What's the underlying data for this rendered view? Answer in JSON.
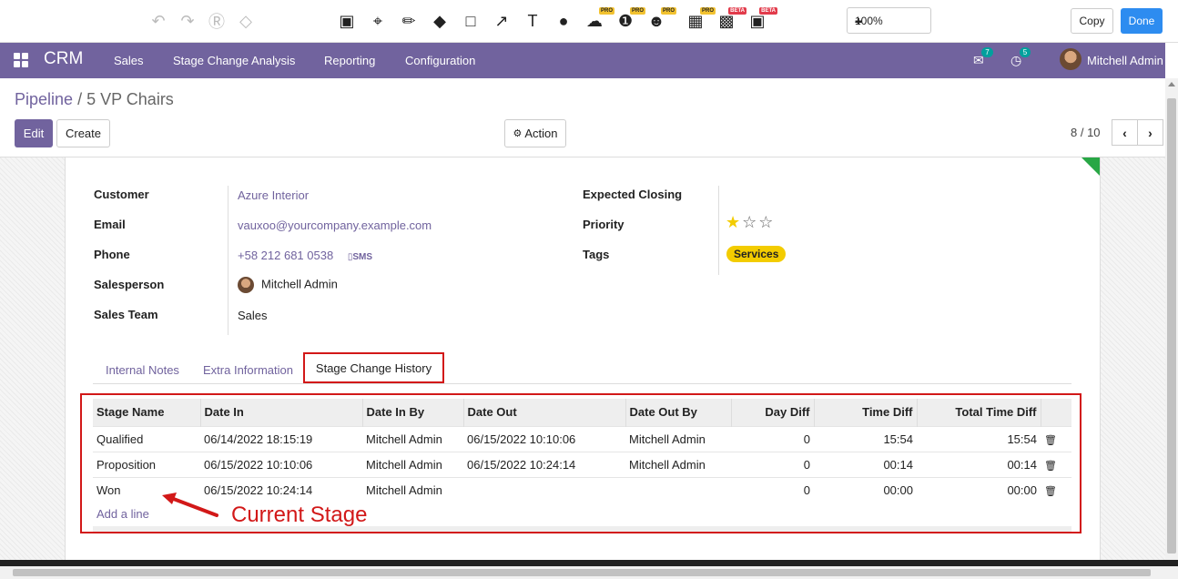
{
  "annotation_toolbar": {
    "zoom": "100%",
    "copy_label": "Copy",
    "done_label": "Done",
    "tools": [
      {
        "icon": "undo-icon"
      },
      {
        "icon": "redo-icon"
      },
      {
        "icon": "ae-icon"
      },
      {
        "icon": "eraser-icon"
      },
      {
        "icon": "resize-icon"
      },
      {
        "icon": "crop-icon"
      },
      {
        "icon": "pencil-icon"
      },
      {
        "icon": "fill-icon"
      },
      {
        "icon": "rectangle-icon"
      },
      {
        "icon": "arrow-icon"
      },
      {
        "icon": "text-icon"
      },
      {
        "icon": "drop-icon"
      },
      {
        "icon": "speech-bubble-icon",
        "badge": "PRO"
      },
      {
        "icon": "number-icon",
        "badge": "PRO"
      },
      {
        "icon": "emoji-icon",
        "badge": "PRO"
      },
      {
        "icon": "image-add-icon",
        "badge": "PRO"
      },
      {
        "icon": "stamp-icon",
        "badge": "BETA"
      },
      {
        "icon": "record-icon",
        "badge": "BETA"
      }
    ]
  },
  "navbar": {
    "app": "CRM",
    "menu": [
      "Sales",
      "Stage Change Analysis",
      "Reporting",
      "Configuration"
    ],
    "messages_count": "7",
    "activities_count": "5",
    "user": "Mitchell Admin"
  },
  "control_panel": {
    "breadcrumb_parent": "Pipeline",
    "breadcrumb_sep": "/",
    "breadcrumb_current": "5 VP Chairs",
    "edit_label": "Edit",
    "create_label": "Create",
    "action_label": "Action",
    "pager": "8 / 10"
  },
  "form": {
    "left": {
      "customer_label": "Customer",
      "customer": "Azure Interior",
      "email_label": "Email",
      "email": "vauxoo@yourcompany.example.com",
      "phone_label": "Phone",
      "phone": "+58 212 681 0538",
      "sms": "SMS",
      "salesperson_label": "Salesperson",
      "salesperson": "Mitchell Admin",
      "team_label": "Sales Team",
      "team": "Sales"
    },
    "right": {
      "closing_label": "Expected Closing",
      "closing": "",
      "priority_label": "Priority",
      "priority_value": 1,
      "priority_max": 3,
      "tags_label": "Tags",
      "tag": "Services"
    }
  },
  "tabs": [
    "Internal Notes",
    "Extra Information",
    "Stage Change History"
  ],
  "history": {
    "columns": [
      "Stage Name",
      "Date In",
      "Date In By",
      "Date Out",
      "Date Out By",
      "Day Diff",
      "Time Diff",
      "Total Time Diff"
    ],
    "rows": [
      [
        "Qualified",
        "06/14/2022 18:15:19",
        "Mitchell Admin",
        "06/15/2022 10:10:06",
        "Mitchell Admin",
        "0",
        "15:54",
        "15:54"
      ],
      [
        "Proposition",
        "06/15/2022 10:10:06",
        "Mitchell Admin",
        "06/15/2022 10:24:14",
        "Mitchell Admin",
        "0",
        "00:14",
        "00:14"
      ],
      [
        "Won",
        "06/15/2022 10:24:14",
        "Mitchell Admin",
        "",
        "",
        "0",
        "00:00",
        "00:00"
      ]
    ],
    "add_line": "Add a line"
  },
  "annotation": {
    "callout": "Current Stage",
    "color": "#d21818"
  }
}
